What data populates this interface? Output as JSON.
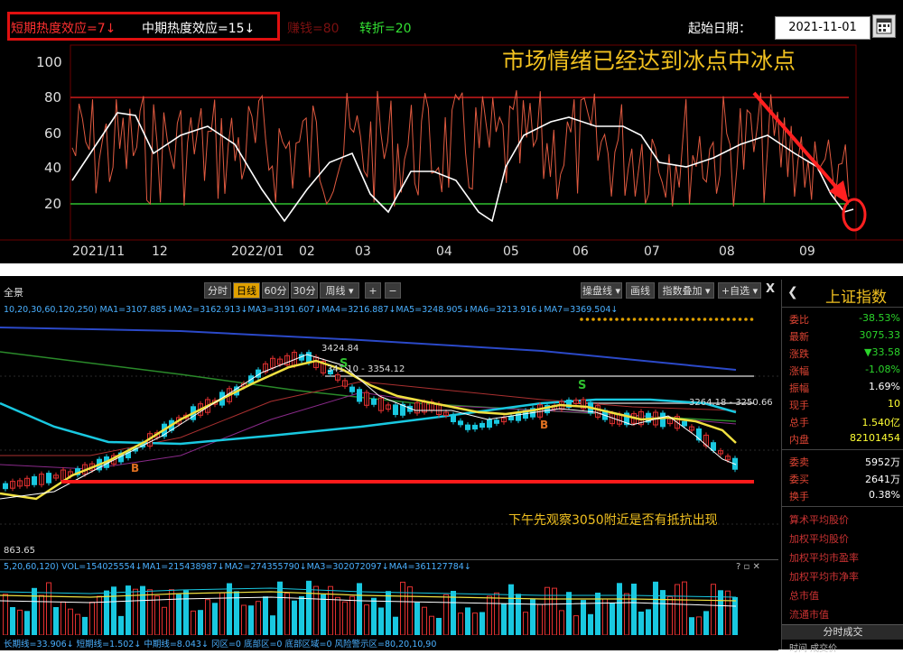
{
  "top": {
    "short_heat": "短期热度效应=7↓",
    "mid_heat": "中期热度效应=15↓",
    "faded_label": "赚钱=80",
    "turn": "转折=20",
    "start_date_label": "起始日期：",
    "start_date_value": "2021-11-01",
    "annotation": "市场情绪已经达到冰点中冰点",
    "y_ticks": [
      "100",
      "80",
      "60",
      "40",
      "20"
    ],
    "x_ticks": [
      "2021/11",
      "12",
      "2022/01",
      "02",
      "03",
      "04",
      "05",
      "06",
      "07",
      "08",
      "09"
    ]
  },
  "kline": {
    "tabs": [
      "分时",
      "日线",
      "60分",
      "30分",
      "周线 ▾",
      "+",
      "−"
    ],
    "right_tabs": [
      "操盘线 ▾",
      "画线",
      "指数叠加 ▾",
      "+自选 ▾"
    ],
    "close_x": "X",
    "corner_label": "全景",
    "ma_line": "10,20,30,60,120,250)  MA1=3107.885↓MA2=3162.913↓MA3=3191.607↓MA4=3216.887↓MA5=3248.905↓MA6=3213.916↓MA7=3369.504↓",
    "high_label": "3424.84",
    "resist_label": "341.10 - 3354.12",
    "range_label": "3264.18 - 3250.66",
    "low_label": "863.65",
    "s_marks": [
      "S",
      "S"
    ],
    "b_marks": [
      "B",
      "B"
    ],
    "annotation": "下午先观察3050附近是否有抵抗出现"
  },
  "volume": {
    "header": "5,20,60,120)  VOL=154025554↓MA1=215438987↓MA2=274355790↓MA3=302072097↓MA4=361127784↓",
    "ctrl": "? ▫ ✕",
    "bottom": "长期线=33.906↓  短期线=1.502↓  中期线=8.043↓  冈区=0  底部区=0  底部区域=0  风险警示区=80,20,10,90"
  },
  "sidebar": {
    "title": "上证指数",
    "rows": [
      {
        "label": "委比",
        "value": "-38.53%",
        "color": "#2bd52b"
      },
      {
        "label": "最新",
        "value": "3075.33",
        "color": "#2bd52b"
      },
      {
        "label": "涨跌",
        "value": "▼33.58",
        "color": "#2bd52b"
      },
      {
        "label": "涨幅",
        "value": "-1.08%",
        "color": "#2bd52b"
      },
      {
        "label": "振幅",
        "value": "1.69%",
        "color": "#ffffff"
      },
      {
        "label": "现手",
        "value": "10",
        "color": "#ffff33"
      },
      {
        "label": "总手",
        "value": "1.540亿",
        "color": "#ffff33"
      },
      {
        "label": "内盘",
        "value": "82101454",
        "color": "#ffff33"
      }
    ],
    "rows2": [
      {
        "label": "委卖",
        "value": "5952万",
        "color": "#ffffff"
      },
      {
        "label": "委买",
        "value": "2641万",
        "color": "#ffffff"
      },
      {
        "label": "换手",
        "value": "0.38%",
        "color": "#ffffff"
      }
    ],
    "links": [
      "算术平均股价",
      "加权平均股价",
      "加权平均市盈率",
      "加权平均市净率",
      "总市值",
      "流通市值"
    ],
    "bottom_btn": "分时成交",
    "bottom_row": "时间      成交价"
  }
}
